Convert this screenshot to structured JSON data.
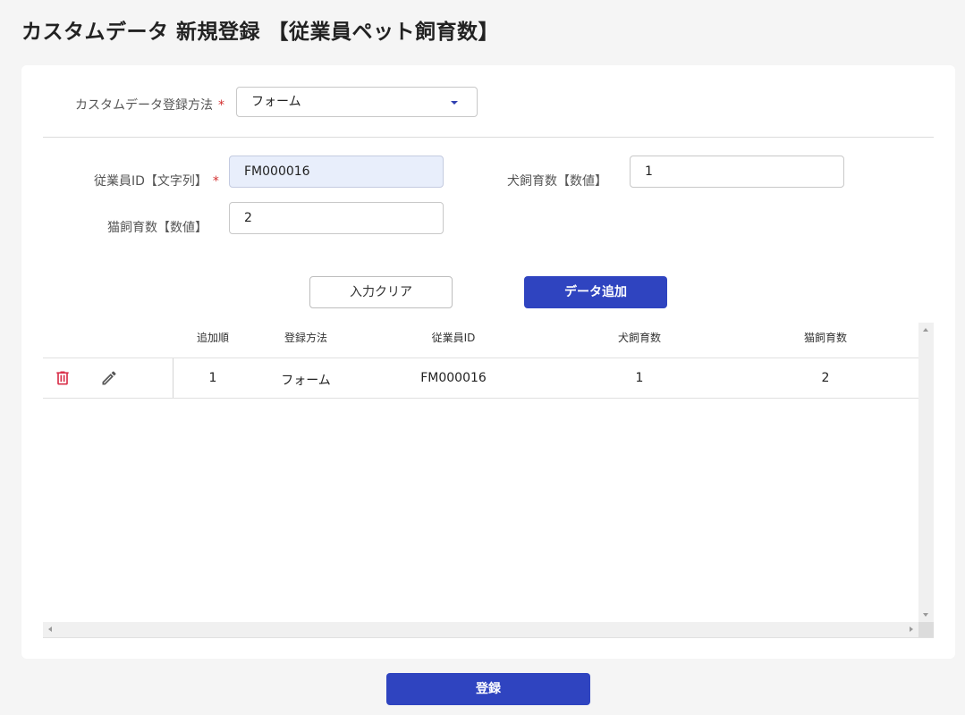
{
  "page": {
    "title": "カスタムデータ 新規登録 【従業員ペット飼育数】"
  },
  "form": {
    "method_label": "カスタムデータ登録方法",
    "method_value": "フォーム",
    "required_mark": "*",
    "fields": [
      {
        "label": "従業員ID【文字列】",
        "value": "FM000016",
        "required": true
      },
      {
        "label": "犬飼育数【数値】",
        "value": "1",
        "required": false
      },
      {
        "label": "猫飼育数【数値】",
        "value": "2",
        "required": false
      }
    ],
    "clear_button": "入力クリア",
    "add_button": "データ追加"
  },
  "table": {
    "columns": [
      "追加順",
      "登録方法",
      "従業員ID",
      "犬飼育数",
      "猫飼育数"
    ],
    "rows": [
      [
        "1",
        "フォーム",
        "FM000016",
        "1",
        "2"
      ]
    ],
    "row_icons": [
      "trash-icon",
      "pencil-icon"
    ]
  },
  "footer": {
    "submit_button": "登録"
  },
  "colors": {
    "primary": "#2f44c0",
    "required": "#d32f2f",
    "delete_icon": "#d9304a",
    "filled_input": "#e8eefb",
    "background": "#f5f5f5"
  }
}
